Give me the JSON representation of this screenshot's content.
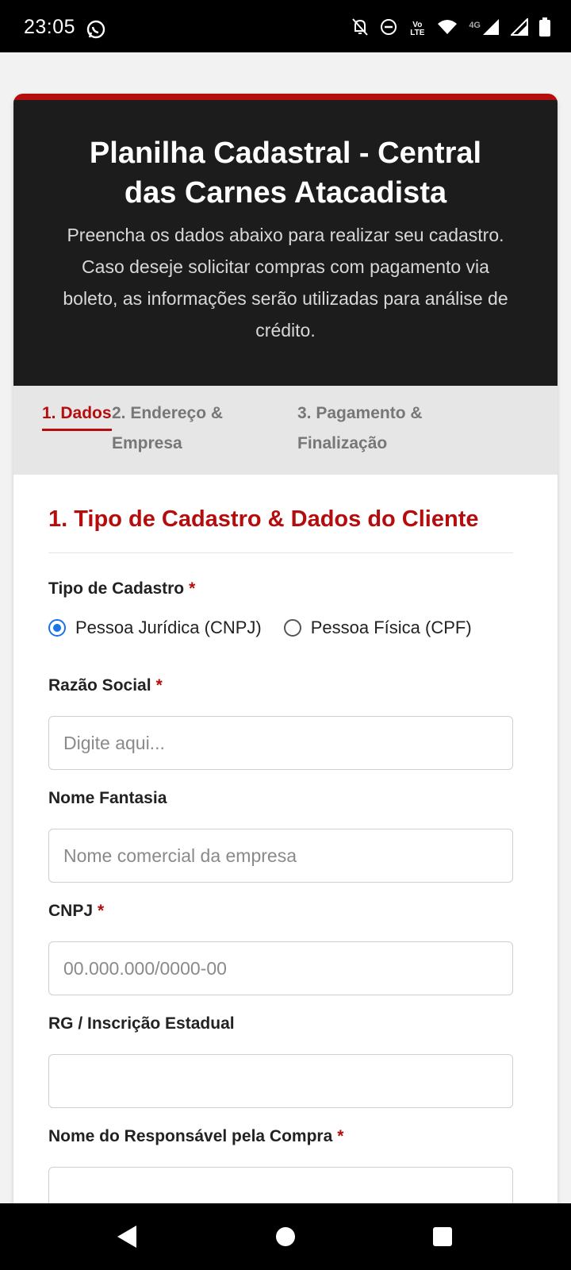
{
  "status_bar": {
    "time": "23:05",
    "network_label": "4G",
    "volte_label": "Vo LTE",
    "icons": [
      "whatsapp-icon",
      "bell-off-icon",
      "dnd-icon",
      "volte-icon",
      "wifi-icon",
      "signal-icon",
      "signal-icon",
      "battery-icon"
    ]
  },
  "header": {
    "title": "Planilha Cadastral - Central das Carnes Atacadista",
    "description": "Preencha os dados abaixo para realizar seu cadastro. Caso deseje solicitar compras com pagamento via boleto, as informações serão utilizadas para análise de crédito."
  },
  "steps": [
    {
      "label": "1. Dados",
      "active": true
    },
    {
      "label": "2. Endereço & Empresa",
      "active": false
    },
    {
      "label": "3. Pagamento & Finalização",
      "active": false
    }
  ],
  "section": {
    "title": "1. Tipo de Cadastro & Dados do Cliente"
  },
  "fields": {
    "tipo_cadastro": {
      "label": "Tipo de Cadastro",
      "required_mark": "*",
      "options": [
        {
          "label": "Pessoa Jurídica (CNPJ)",
          "selected": true
        },
        {
          "label": "Pessoa Física (CPF)",
          "selected": false
        }
      ]
    },
    "razao_social": {
      "label": "Razão Social",
      "required_mark": "*",
      "value": "",
      "placeholder": "Digite aqui..."
    },
    "nome_fantasia": {
      "label": "Nome Fantasia",
      "value": "",
      "placeholder": "Nome comercial da empresa"
    },
    "cnpj": {
      "label": "CNPJ",
      "required_mark": "*",
      "value": "",
      "placeholder": "00.000.000/0000-00"
    },
    "rg_ie": {
      "label": "RG / Inscrição Estadual",
      "value": "",
      "placeholder": ""
    },
    "responsavel": {
      "label": "Nome do Responsável pela Compra",
      "required_mark": "*",
      "value": "",
      "placeholder": ""
    }
  },
  "colors": {
    "accent": "#b50d0d",
    "header_bg": "#1c1c1c",
    "radio_selected": "#1a73e8"
  }
}
